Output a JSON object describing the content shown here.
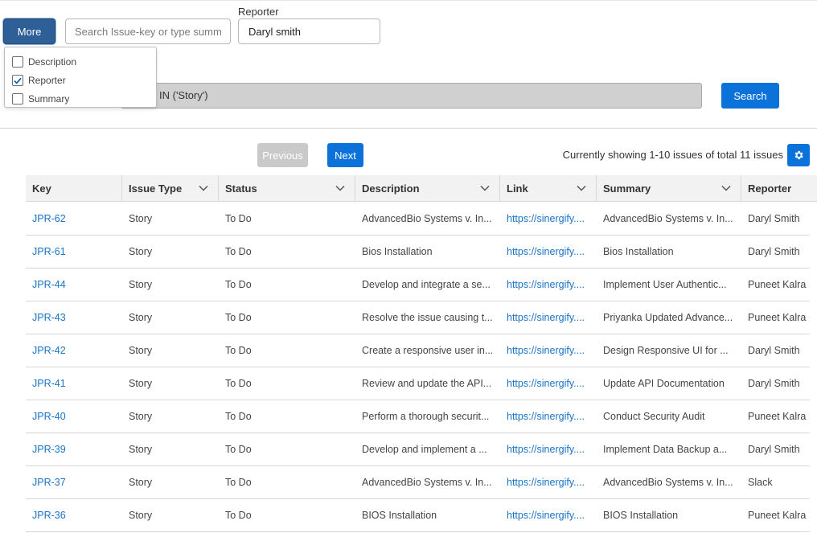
{
  "toolbar": {
    "more_label": "More",
    "search_placeholder": "Search Issue-key or type summ",
    "reporter_label": "Reporter",
    "reporter_value": "Daryl smith",
    "jql_visible_text": "IN ('Story')",
    "search_label": "Search"
  },
  "more_menu": {
    "items": [
      {
        "label": "Description",
        "checked": false
      },
      {
        "label": "Reporter",
        "checked": true
      },
      {
        "label": "Summary",
        "checked": false
      }
    ]
  },
  "pagination": {
    "previous_label": "Previous",
    "next_label": "Next",
    "showing_text": "Currently showing 1-10 issues of total 11 issues"
  },
  "icons": {
    "settings": "gear-icon",
    "column_menu": "chevron-down-icon",
    "checkbox_checked": "checkmark-icon"
  },
  "colors": {
    "primary": "#0b72d9",
    "more_button": "#2e5f96",
    "link": "#1a73c8",
    "disabled_button": "#c9c9c9"
  },
  "table": {
    "columns": [
      "Key",
      "Issue Type",
      "Status",
      "Description",
      "Link",
      "Summary",
      "Reporter"
    ],
    "rows": [
      {
        "key": "JPR-62",
        "type": "Story",
        "status": "To Do",
        "description": "AdvancedBio Systems v. In...",
        "link": "https://sinergify....",
        "summary": "AdvancedBio Systems v. In...",
        "reporter": "Daryl Smith"
      },
      {
        "key": "JPR-61",
        "type": "Story",
        "status": "To Do",
        "description": "Bios Installation",
        "link": "https://sinergify....",
        "summary": "Bios Installation",
        "reporter": "Daryl Smith"
      },
      {
        "key": "JPR-44",
        "type": "Story",
        "status": "To Do",
        "description": "Develop and integrate a se...",
        "link": "https://sinergify....",
        "summary": "Implement User Authentic...",
        "reporter": "Puneet Kalra"
      },
      {
        "key": "JPR-43",
        "type": "Story",
        "status": "To Do",
        "description": "Resolve the issue causing t...",
        "link": "https://sinergify....",
        "summary": "Priyanka Updated Advance...",
        "reporter": "Puneet Kalra"
      },
      {
        "key": "JPR-42",
        "type": "Story",
        "status": "To Do",
        "description": "Create a responsive user in...",
        "link": "https://sinergify....",
        "summary": "Design Responsive UI for ...",
        "reporter": "Daryl Smith"
      },
      {
        "key": "JPR-41",
        "type": "Story",
        "status": "To Do",
        "description": "Review and update the API...",
        "link": "https://sinergify....",
        "summary": "Update API Documentation",
        "reporter": "Daryl Smith"
      },
      {
        "key": "JPR-40",
        "type": "Story",
        "status": "To Do",
        "description": "Perform a thorough securit...",
        "link": "https://sinergify....",
        "summary": "Conduct Security Audit",
        "reporter": "Puneet Kalra"
      },
      {
        "key": "JPR-39",
        "type": "Story",
        "status": "To Do",
        "description": "Develop and implement a ...",
        "link": "https://sinergify....",
        "summary": "Implement Data Backup a...",
        "reporter": "Daryl Smith"
      },
      {
        "key": "JPR-37",
        "type": "Story",
        "status": "To Do",
        "description": "AdvancedBio Systems v. In...",
        "link": "https://sinergify....",
        "summary": "AdvancedBio Systems v. In...",
        "reporter": "Slack"
      },
      {
        "key": "JPR-36",
        "type": "Story",
        "status": "To Do",
        "description": "BIOS Installation",
        "link": "https://sinergify....",
        "summary": "BIOS Installation",
        "reporter": "Puneet Kalra"
      }
    ]
  }
}
